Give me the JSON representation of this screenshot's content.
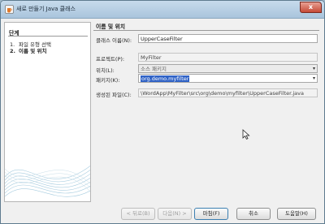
{
  "window": {
    "title": "새로 만들기 Java 클래스",
    "close_label": "x"
  },
  "steps": {
    "heading": "단계",
    "items": [
      {
        "number": "1.",
        "label": "파일 유형 선택",
        "current": false
      },
      {
        "number": "2.",
        "label": "이름 및 위치",
        "current": true
      }
    ]
  },
  "form": {
    "heading": "이름 및 위치",
    "class_name": {
      "label": "클래스 이름(N):",
      "value": "UpperCaseFilter"
    },
    "project": {
      "label": "프로젝트(P):",
      "value": "MyFilter"
    },
    "location": {
      "label": "위치(L):",
      "value": "소스 패키지"
    },
    "package": {
      "label": "패키지(K):",
      "value": "org.demo.myfilter"
    },
    "created_file": {
      "label": "생성된 파일(C):",
      "value": "\\WordApp\\MyFilter\\src\\org\\demo\\myfilter\\UpperCaseFilter.java"
    }
  },
  "buttons": {
    "back": "< 뒤로(B)",
    "next": "다음(N) >",
    "finish": "마침(F)",
    "cancel": "취소",
    "help": "도움말(H)"
  },
  "colors": {
    "titlebar": "#b9d1e7",
    "selection": "#2f62c6"
  }
}
